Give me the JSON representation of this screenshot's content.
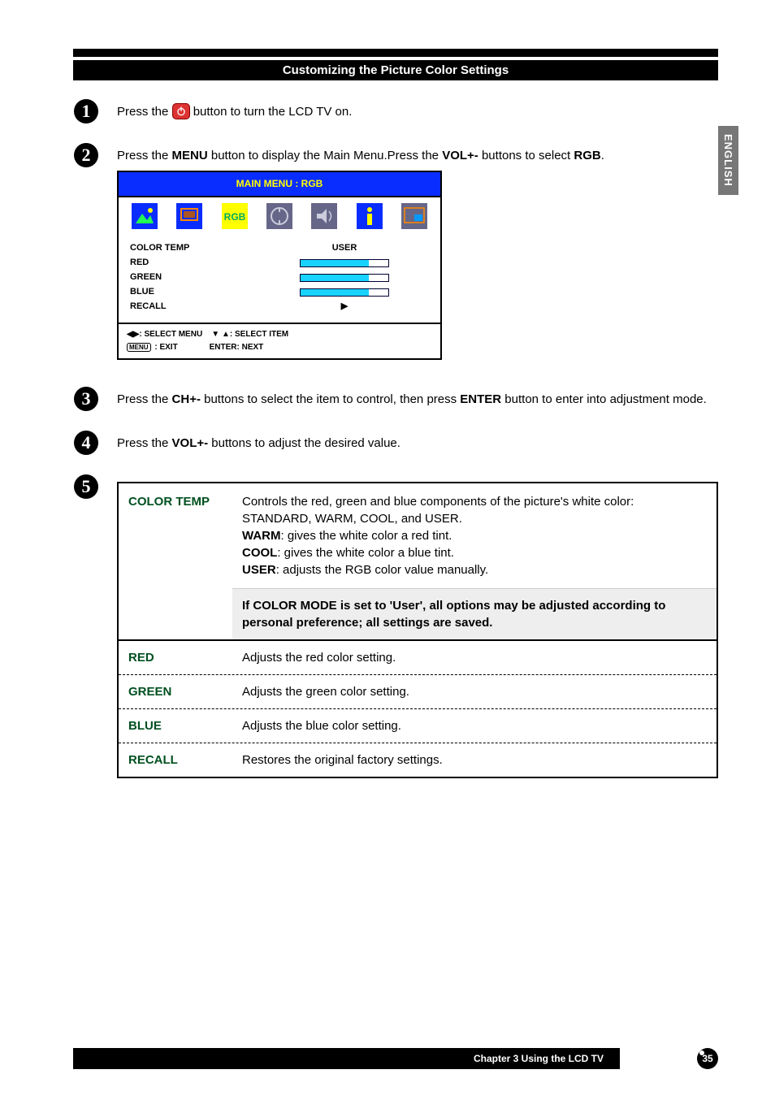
{
  "side_tab": "ENGLISH",
  "section_title": "Customizing the Picture Color Settings",
  "steps": {
    "s1": {
      "pre": "Press the ",
      "post": "button to turn the LCD TV on."
    },
    "s2": {
      "t1": "Press the ",
      "b1": "MENU",
      "t2": " button to display the Main Menu.Press the ",
      "b2": "VOL+-",
      "t3": " buttons to select ",
      "b3": "RGB",
      "t4": "."
    },
    "s3": {
      "t1": "Press the ",
      "b1": "CH+-",
      "t2": " buttons to select the item to control, then press ",
      "b2": "ENTER",
      "t3": " button to enter into adjustment mode."
    },
    "s4": {
      "t1": "Press the ",
      "b1": "VOL+-",
      "t2": " buttons to adjust the desired value."
    }
  },
  "osd": {
    "header": "MAIN MENU : RGB",
    "rows": {
      "colortemp": {
        "label": "COLOR TEMP",
        "value": "USER"
      },
      "red": {
        "label": "RED"
      },
      "green": {
        "label": "GREEN"
      },
      "blue": {
        "label": "BLUE"
      },
      "recall": {
        "label": "RECALL"
      }
    },
    "footer": {
      "selmenu": ": SELECT MENU",
      "selitem": ": SELECT ITEM",
      "exit": " : EXIT",
      "enter": "ENTER: NEXT"
    }
  },
  "table": {
    "colortemp": {
      "label": "COLOR TEMP",
      "d1": "Controls the red, green and blue components of the picture's white color: STANDARD, WARM,  COOL, and USER.",
      "warm_b": "WARM",
      "warm_t": ": gives the white color a red tint.",
      "cool_b": "COOL",
      "cool_t": ": gives the white color a blue tint.",
      "user_b": "USER",
      "user_t": ": adjusts the RGB color value manually.",
      "note": "If COLOR MODE is set to 'User', all options may be adjusted according to personal preference; all settings are saved."
    },
    "red": {
      "label": "RED",
      "desc": "Adjusts the red color setting."
    },
    "green": {
      "label": "GREEN",
      "desc": "Adjusts the green color setting."
    },
    "blue": {
      "label": "BLUE",
      "desc": "Adjusts the blue color setting."
    },
    "recall": {
      "label": "RECALL",
      "desc": "Restores the original factory settings."
    }
  },
  "footer": {
    "chapter": "Chapter 3 Using the LCD TV",
    "page": "35"
  }
}
